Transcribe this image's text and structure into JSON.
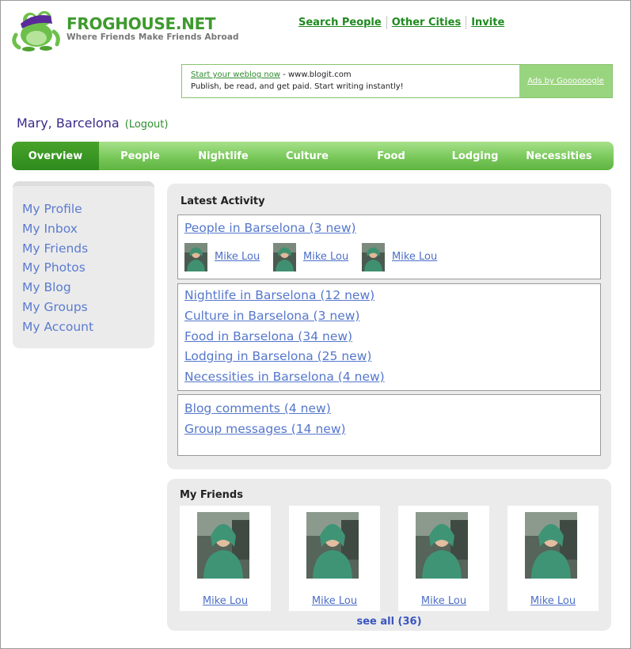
{
  "brand": {
    "name": "FROGHOUSE.NET",
    "tagline": "Where Friends Make Friends Abroad"
  },
  "top_links": [
    "Search People",
    "Other Cities",
    "Invite"
  ],
  "ad": {
    "link_text": "Start your weblog now",
    "url_text": "- www.blogit.com",
    "body": "Publish, be read, and get paid. Start writing instantly!",
    "side_link": "Ads by Goooooogle"
  },
  "user": {
    "greeting": "Mary, Barcelona",
    "logout": "(Logout)"
  },
  "nav": {
    "tabs": [
      "Overview",
      "People",
      "Nightlife",
      "Culture",
      "Food",
      "Lodging",
      "Necessities"
    ],
    "active": "Overview"
  },
  "sidebar": {
    "items": [
      "My Profile",
      "My Inbox",
      "My Friends",
      "My Photos",
      "My Blog",
      "My Groups",
      "My Account"
    ]
  },
  "latest": {
    "title": "Latest Activity",
    "people_link": "People in Barselona (3 new)",
    "people": [
      "Mike Lou",
      "Mike Lou",
      "Mike Lou"
    ],
    "city_links": [
      "Nightlife in Barselona (12 new)",
      "Culture in Barselona (3 new)",
      "Food in Barselona (34 new)",
      "Lodging in Barselona (25 new)",
      "Necessities in Barselona (4 new)"
    ],
    "personal_links": [
      "Blog comments (4 new)",
      "Group messages (14 new)"
    ]
  },
  "friends": {
    "title": "My Friends",
    "names": [
      "Mike Lou",
      "Mike Lou",
      "Mike Lou",
      "Mike Lou"
    ],
    "see_all": "see all (36)"
  },
  "colors": {
    "brand_green": "#3d9a2d",
    "nav_green": "#79c85b",
    "nav_active": "#2e8b1d",
    "link_blue": "#5577cc",
    "panel_gray": "#ebebeb"
  }
}
